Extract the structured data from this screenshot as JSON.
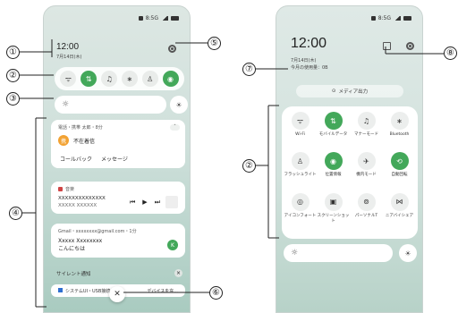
{
  "left": {
    "status": "8:5G",
    "time": "12:00",
    "date": "7月14日(木)",
    "quick_toggles": [
      {
        "icon": "wifi-icon",
        "glyph": "ᯤ",
        "on": false
      },
      {
        "icon": "mobile-data-icon",
        "glyph": "⇅",
        "on": true
      },
      {
        "icon": "bell-icon",
        "glyph": "♫",
        "on": false
      },
      {
        "icon": "bluetooth-icon",
        "glyph": "∗",
        "on": false
      },
      {
        "icon": "flashlight-icon",
        "glyph": "♙",
        "on": false
      },
      {
        "icon": "location-icon",
        "glyph": "◉",
        "on": true
      }
    ],
    "notifications": {
      "call": {
        "header": "電話・携帯 太郎・8分",
        "icon_text": "携",
        "title": "不在着信",
        "actions": [
          "コールバック",
          "メッセージ"
        ]
      },
      "music": {
        "app": "音楽",
        "title": "XXXXXXXXXXXXXX",
        "subtitle": "XXXXX XXXXXX"
      },
      "gmail": {
        "header": "Gmail・xxxxxxxx@gmail.com・1分",
        "sender": "Xxxxx Xxxxxxxx",
        "message": "こんにちは",
        "avatar": "K"
      },
      "silent_label": "サイレント通知",
      "system": "システムUI・USB接続",
      "system_suffix": "デバイスを充..."
    }
  },
  "right": {
    "status": "8:5G",
    "time": "12:00",
    "date": "7月14日(木)",
    "usage": "今月の使用量：0B",
    "media_output": "メディア出力",
    "tiles": [
      {
        "icon": "wifi-icon",
        "glyph": "ᯤ",
        "label": "Wi-Fi",
        "on": false
      },
      {
        "icon": "mobile-data-icon",
        "glyph": "⇅",
        "label": "モバイルデータ",
        "on": true
      },
      {
        "icon": "bell-icon",
        "glyph": "♫",
        "label": "マナーモード",
        "on": false
      },
      {
        "icon": "bluetooth-icon",
        "glyph": "∗",
        "label": "Bluetooth",
        "on": false
      },
      {
        "icon": "flashlight-icon",
        "glyph": "♙",
        "label": "フラッシュライト",
        "on": false
      },
      {
        "icon": "location-icon",
        "glyph": "◉",
        "label": "位置情報",
        "on": true
      },
      {
        "icon": "airplane-icon",
        "glyph": "✈",
        "label": "機内モード",
        "on": false
      },
      {
        "icon": "auto-rotate-icon",
        "glyph": "⟲",
        "label": "自動回転",
        "on": true
      },
      {
        "icon": "eye-comfort-icon",
        "glyph": "◎",
        "label": "アイコンフォート",
        "on": false
      },
      {
        "icon": "screenshot-icon",
        "glyph": "▣",
        "label": "スクリーンショット",
        "on": false
      },
      {
        "icon": "hotspot-icon",
        "glyph": "⊚",
        "label": "パーソナルT",
        "on": false
      },
      {
        "icon": "nearby-share-icon",
        "glyph": "⋈",
        "label": "ニアバイシェア",
        "on": false
      }
    ]
  },
  "callouts": [
    "①",
    "②",
    "③",
    "④",
    "⑤",
    "⑥",
    "⑦",
    "⑧"
  ]
}
